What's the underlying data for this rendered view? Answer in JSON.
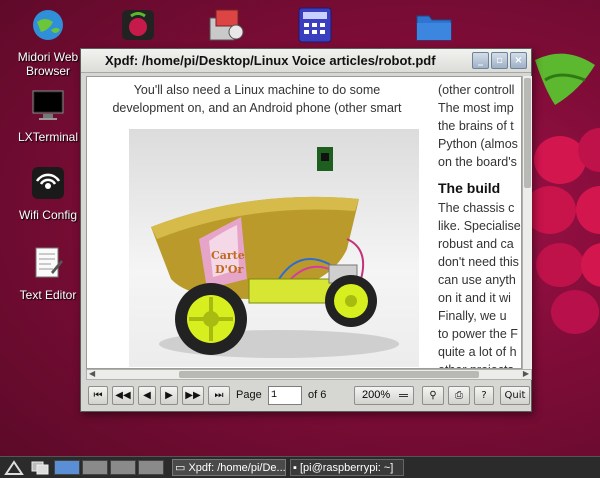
{
  "desktop": {
    "icons": [
      {
        "name": "midori",
        "label_line1": "Midori Web",
        "label_line2": "Browser"
      },
      {
        "name": "lxterminal",
        "label": "LXTerminal"
      },
      {
        "name": "wifi",
        "label": "Wifi Config"
      },
      {
        "name": "text-editor",
        "label": "Text Editor"
      }
    ],
    "top_icons": [
      "raspberry-pi-store-icon",
      "package-manager-icon",
      "calculator-icon",
      "folder-icon"
    ]
  },
  "window": {
    "title": "Xpdf: /home/pi/Desktop/Linux Voice articles/robot.pdf",
    "buttons": {
      "minimize": "_",
      "maximize": "▫",
      "close": "×"
    }
  },
  "document": {
    "col1_lines": [
      "You'll also need a Linux machine to do some",
      "development on, and an Android phone (other smart"
    ],
    "col2_lines_top": [
      "(other controll",
      "The most imp",
      "the brains of t",
      "Python (almos",
      "on the board's"
    ],
    "col2_heading": "The build",
    "col2_lines_bottom": [
      "The chassis c",
      "like. Specialise",
      "robust and ca",
      "don't need this",
      "can use anyth",
      "on it and it wi",
      "  Finally, we u",
      "to power the F",
      "quite a lot of h",
      "other projects"
    ]
  },
  "toolbar": {
    "page_label": "Page",
    "page_value": "1",
    "of_label": "of 6",
    "zoom_value": "200%",
    "quit_label": "Quit"
  },
  "taskbar": {
    "xpdf_task": "Xpdf: /home/pi/De...",
    "terminal_task": "[pi@raspberrypi: ~]"
  }
}
